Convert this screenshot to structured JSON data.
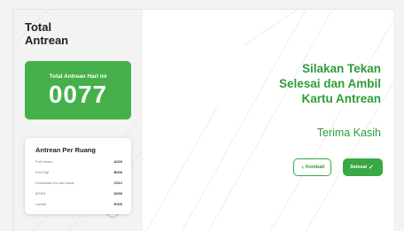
{
  "header": {
    "title_line1": "Total",
    "title_line2": "Antrean"
  },
  "total_card": {
    "label": "Total Antrean Hari ini",
    "count": "0077"
  },
  "rooms": {
    "title": "Antrean Per Ruang",
    "items": [
      {
        "name": "Poli Umum",
        "code": "A025"
      },
      {
        "name": "Poli Gigi",
        "code": "B005"
      },
      {
        "name": "Kesehatan Ibu dan Anak",
        "code": "C012"
      },
      {
        "name": "MTBS",
        "code": "D009"
      },
      {
        "name": "Lansia",
        "code": "E005"
      }
    ]
  },
  "message": {
    "line1": "Silakan Tekan",
    "line2": "Selesai dan Ambil",
    "line3": "Kartu Antrean",
    "thanks": "Terima Kasih"
  },
  "actions": {
    "back_label": "Kembali",
    "back_icon": "chevron-left-icon",
    "done_label": "Selesai",
    "done_icon": "check-icon"
  },
  "colors": {
    "accent": "#45b04a",
    "text_green": "#2e9d39",
    "background": "#f2f3f2"
  }
}
